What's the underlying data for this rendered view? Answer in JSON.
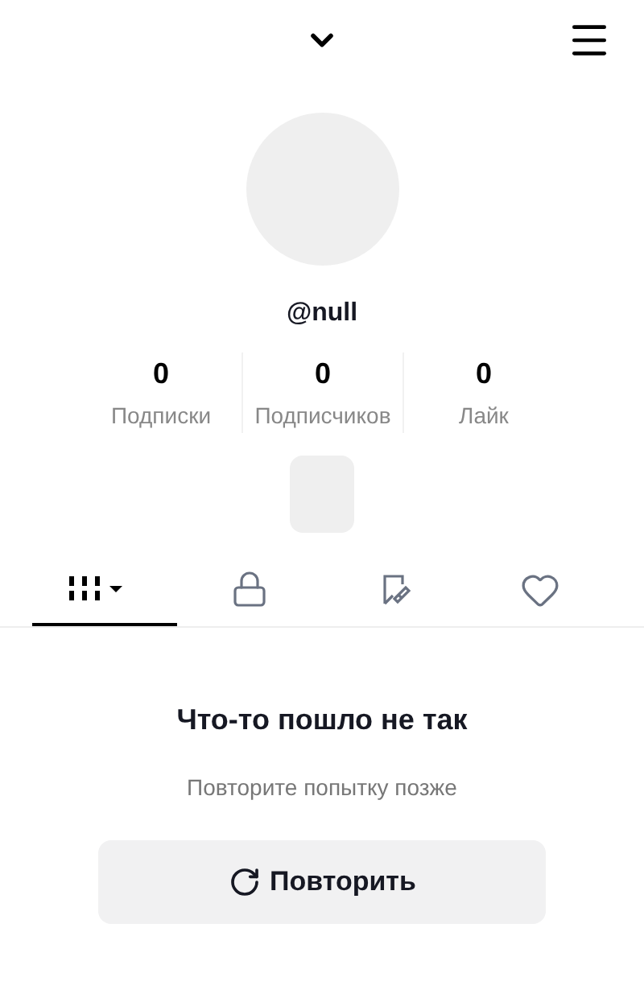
{
  "profile": {
    "username": "@null"
  },
  "stats": [
    {
      "value": "0",
      "label": "Подписки"
    },
    {
      "value": "0",
      "label": "Подписчиков"
    },
    {
      "value": "0",
      "label": "Лайк"
    }
  ],
  "tabs": [
    {
      "kind": "grid",
      "selected": true
    },
    {
      "kind": "lock",
      "selected": false
    },
    {
      "kind": "tagged",
      "selected": false
    },
    {
      "kind": "liked",
      "selected": false
    }
  ],
  "error": {
    "title": "Что-то пошло не так",
    "message": "Повторите попытку позже",
    "button": "Повторить"
  }
}
